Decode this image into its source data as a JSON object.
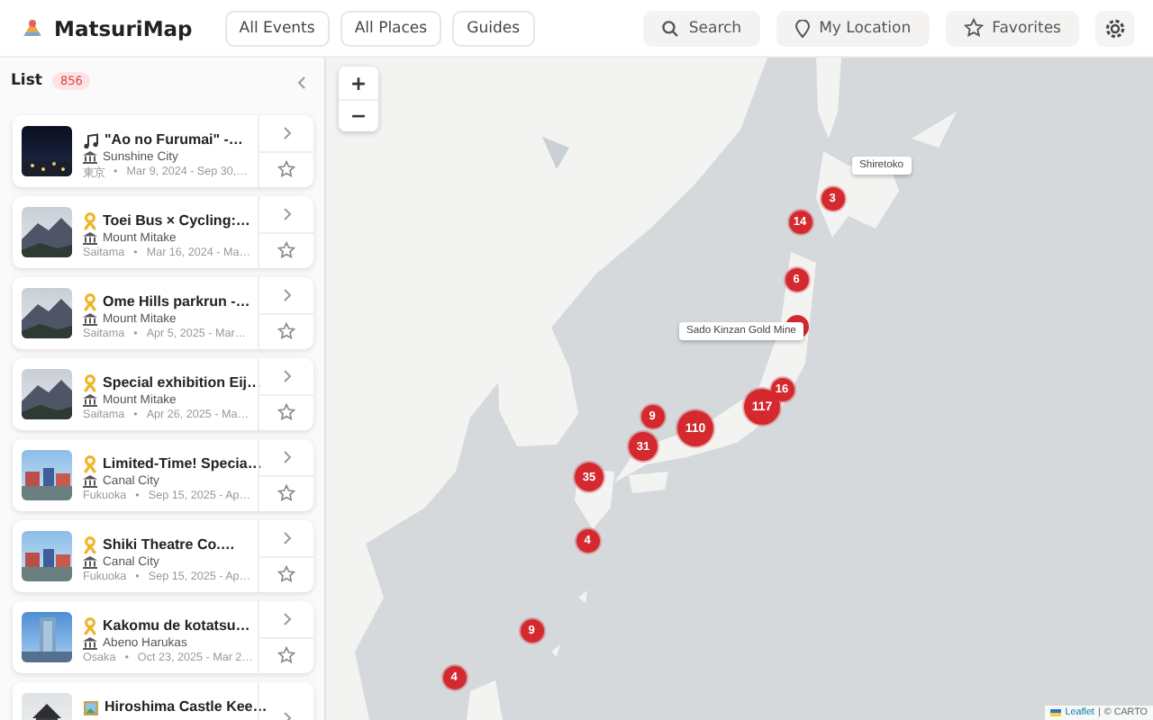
{
  "header": {
    "app_name": "MatsuriMap",
    "nav": [
      {
        "label": "All Events"
      },
      {
        "label": "All Places"
      },
      {
        "label": "Guides"
      }
    ],
    "actions": [
      {
        "kind": "search",
        "label": "Search"
      },
      {
        "kind": "location",
        "label": "My Location"
      },
      {
        "kind": "favorites",
        "label": "Favorites"
      },
      {
        "kind": "settings"
      }
    ]
  },
  "list": {
    "title": "List",
    "count": "856",
    "events": [
      {
        "kind": "music",
        "title": "\"Ao no Furumai\" -…",
        "place": "Sunshine City",
        "region": "東京",
        "sep": "•",
        "dates": "Mar 9, 2024 - Sep 30,…"
      },
      {
        "kind": "ribbon",
        "title": "Toei Bus × Cycling:…",
        "place": "Mount Mitake",
        "region": "Saitama",
        "sep": "•",
        "dates": "Mar 16, 2024 - Ma…"
      },
      {
        "kind": "ribbon",
        "title": "Ome Hills parkrun -…",
        "place": "Mount Mitake",
        "region": "Saitama",
        "sep": "•",
        "dates": "Apr 5, 2025 - Mar…"
      },
      {
        "kind": "ribbon",
        "title": "Special exhibition Eij…",
        "place": "Mount Mitake",
        "region": "Saitama",
        "sep": "•",
        "dates": "Apr 26, 2025 - Ma…"
      },
      {
        "kind": "ribbon",
        "title": "Limited-Time! Specia…",
        "place": "Canal City",
        "region": "Fukuoka",
        "sep": "•",
        "dates": "Sep 15, 2025 - Ap…"
      },
      {
        "kind": "ribbon",
        "title": "Shiki Theatre Co.…",
        "place": "Canal City",
        "region": "Fukuoka",
        "sep": "•",
        "dates": "Sep 15, 2025 - Ap…"
      },
      {
        "kind": "ribbon",
        "title": "Kakomu de kotatsu…",
        "place": "Abeno Harukas",
        "region": "Osaka",
        "sep": "•",
        "dates": "Oct 23, 2025 - Mar 2…"
      },
      {
        "kind": "art",
        "title": "Hiroshima Castle Kee…"
      }
    ]
  },
  "map": {
    "clusters": [
      {
        "covered": false,
        "count": "3"
      },
      {
        "covered": false,
        "count": "14"
      },
      {
        "covered": false,
        "count": "6"
      },
      {
        "covered": true
      },
      {
        "covered": false,
        "count": "16"
      },
      {
        "covered": false,
        "count": "117"
      },
      {
        "covered": false,
        "count": "110"
      },
      {
        "covered": false,
        "count": "9"
      },
      {
        "covered": false,
        "count": "31"
      },
      {
        "covered": false,
        "count": "35"
      },
      {
        "covered": false,
        "count": "4"
      },
      {
        "covered": false,
        "count": "9"
      },
      {
        "covered": false,
        "count": "4"
      }
    ],
    "tooltips": [
      {
        "label": "Shiretoko"
      },
      {
        "label": "Sado Kinzan Gold Mine"
      }
    ],
    "zoom": [
      {
        "kind": "in",
        "label": "+"
      },
      {
        "kind": "out",
        "label": "−"
      }
    ],
    "attribution": {
      "library": "Leaflet",
      "separator": "|",
      "credit": "© CARTO"
    }
  }
}
